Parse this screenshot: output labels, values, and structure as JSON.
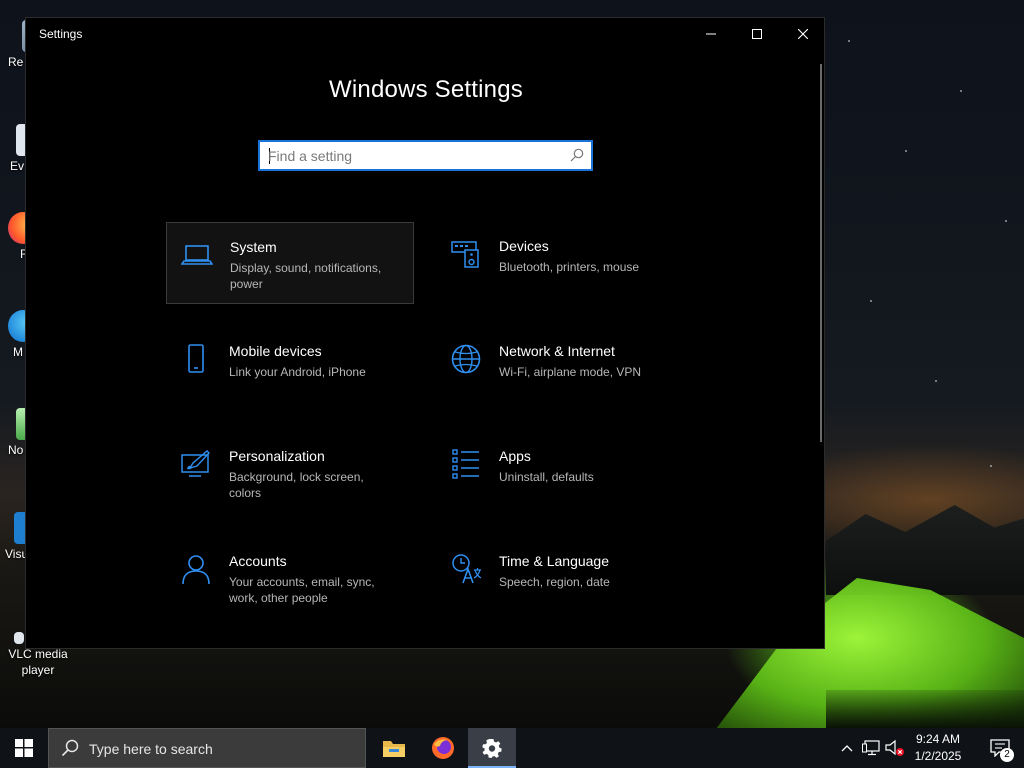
{
  "desktop": {
    "icons": [
      {
        "label": "Re",
        "icon": "recycle-bin-icon"
      },
      {
        "label": "Ev",
        "icon": "shortcut-icon"
      },
      {
        "label": "F",
        "icon": "firefox-shortcut-icon"
      },
      {
        "label": "M",
        "icon": "edge-shortcut-icon"
      },
      {
        "label": "No",
        "icon": "notepad-shortcut-icon"
      },
      {
        "label": "Visu",
        "icon": "vscode-shortcut-icon"
      },
      {
        "label": "VLC media player",
        "icon": "vlc-icon"
      }
    ]
  },
  "window": {
    "title": "Settings",
    "controls": {
      "minimize": "minimize-icon",
      "maximize": "maximize-icon",
      "close": "close-icon"
    }
  },
  "settings": {
    "heading": "Windows Settings",
    "search_placeholder": "Find a setting",
    "search_value": "",
    "accent_color": "#1a73d9",
    "tiles": [
      {
        "title": "System",
        "desc": "Display, sound, notifications, power",
        "icon": "laptop-icon",
        "selected": true
      },
      {
        "title": "Devices",
        "desc": "Bluetooth, printers, mouse",
        "icon": "devices-icon"
      },
      {
        "title": "Mobile devices",
        "desc": "Link your Android, iPhone",
        "icon": "phone-icon"
      },
      {
        "title": "Network & Internet",
        "desc": "Wi-Fi, airplane mode, VPN",
        "icon": "globe-icon"
      },
      {
        "title": "Personalization",
        "desc": "Background, lock screen, colors",
        "icon": "personalization-icon"
      },
      {
        "title": "Apps",
        "desc": "Uninstall, defaults",
        "icon": "apps-list-icon"
      },
      {
        "title": "Accounts",
        "desc": "Your accounts, email, sync, work, other people",
        "icon": "person-icon"
      },
      {
        "title": "Time & Language",
        "desc": "Speech, region, date",
        "icon": "time-language-icon"
      }
    ]
  },
  "taskbar": {
    "search_text": "Type here to search",
    "apps": [
      {
        "name": "file-explorer",
        "icon": "folder-icon"
      },
      {
        "name": "firefox",
        "icon": "firefox-icon"
      },
      {
        "name": "settings",
        "icon": "gear-icon",
        "active": true
      }
    ],
    "tray_icons": [
      "chevron-up-icon",
      "network-icon",
      "volume-muted-icon"
    ],
    "time": "9:24 AM",
    "date": "1/2/2025",
    "notification_count": "2"
  }
}
